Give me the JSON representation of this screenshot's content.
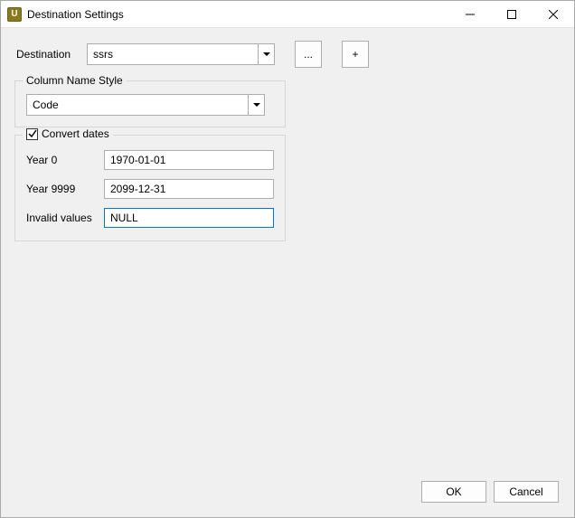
{
  "window": {
    "title": "Destination Settings",
    "icon_letter": "U"
  },
  "destination": {
    "label": "Destination",
    "value": "ssrs",
    "browse_label": "...",
    "add_label": "+"
  },
  "column_name_style": {
    "group_label": "Column Name Style",
    "value": "Code"
  },
  "convert_dates": {
    "group_label": "Convert dates",
    "checked": true,
    "year0_label": "Year 0",
    "year0_value": "1970-01-01",
    "year9999_label": "Year 9999",
    "year9999_value": "2099-12-31",
    "invalid_label": "Invalid values",
    "invalid_value": "NULL"
  },
  "footer": {
    "ok": "OK",
    "cancel": "Cancel"
  }
}
